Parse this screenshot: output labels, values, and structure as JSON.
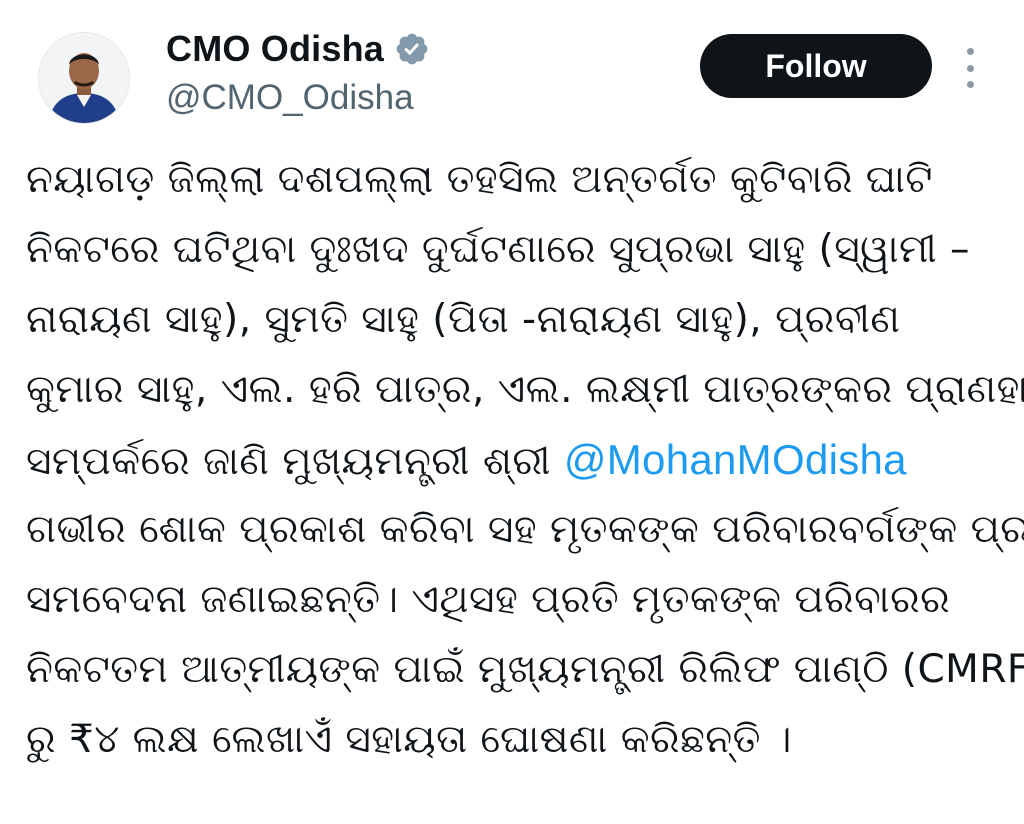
{
  "account": {
    "name": "CMO Odisha",
    "handle": "@CMO_Odisha",
    "verified": true
  },
  "follow_button": {
    "label": "Follow"
  },
  "tweet": {
    "lines": [
      {
        "before": "ନୟାଗଡ଼ ଜିଲ୍ଲା ଦଶପଲ୍ଲା ତହସିଲ ଅନ୍ତର୍ଗତ କୁଟିବାରି ଘାଟି",
        "mention": "",
        "after": ""
      },
      {
        "before": "ନିକଟରେ ଘଟିଥିବା ଦୁଃଖଦ ଦୁର୍ଘଟଣାରେ ସୁପ୍ରଭା ସାହୁ (ସ୍ୱାମୀ –",
        "mention": "",
        "after": ""
      },
      {
        "before": "ନାରାୟଣ ସାହୁ),  ସୁମତି ସାହୁ (ପିତା -ନାରାୟଣ ସାହୁ), ପ୍ରବୀଣ",
        "mention": "",
        "after": ""
      },
      {
        "before": "କୁମାର ସାହୁ, ଏଲ. ହରି ପାତ୍ର, ଏଲ. ଲକ୍ଷ୍ମୀ ପାତ୍ରଙ୍କର ପ୍ରାଣହାନି",
        "mention": "",
        "after": ""
      },
      {
        "before": "ସମ୍ପର୍କରେ ଜାଣି ମୁଖ୍ୟମନ୍ତ୍ରୀ ଶ୍ରୀ ",
        "mention": "@MohanMOdisha",
        "after": ""
      },
      {
        "before": "ଗଭୀର ଶୋକ ପ୍ରକାଶ କରିବା ସହ ମୃତକଙ୍କ ପରିବାରବର୍ଗଙ୍କ ପ୍ରତି",
        "mention": "",
        "after": ""
      },
      {
        "before": "ସମବେଦନା ଜଣାଇଛନ୍ତି। ଏଥିସହ ପ୍ରତି ମୃତକଙ୍କ ପରିବାରର",
        "mention": "",
        "after": ""
      },
      {
        "before": "ନିକଟତମ ଆତ୍ମୀୟଙ୍କ ପାଇଁ ମୁଖ୍ୟମନ୍ତ୍ରୀ ରିଲିଫ ପାଣ୍ଠି (CMRF)",
        "mention": "",
        "after": ""
      },
      {
        "before": "ରୁ ₹୪ ଲକ୍ଷ ଲେଖାଏଁ ସହାୟତା ଘୋଷଣା କରିଛନ୍ତି ।",
        "mention": "",
        "after": ""
      }
    ]
  },
  "icons": {
    "verified": "verified-badge-icon",
    "more": "more-vertical-icon",
    "avatar": "profile-avatar"
  },
  "colors": {
    "follow_bg": "#0f1419",
    "mention": "#1d9bf0",
    "handle": "#536471",
    "verified_badge": "#829aab"
  }
}
